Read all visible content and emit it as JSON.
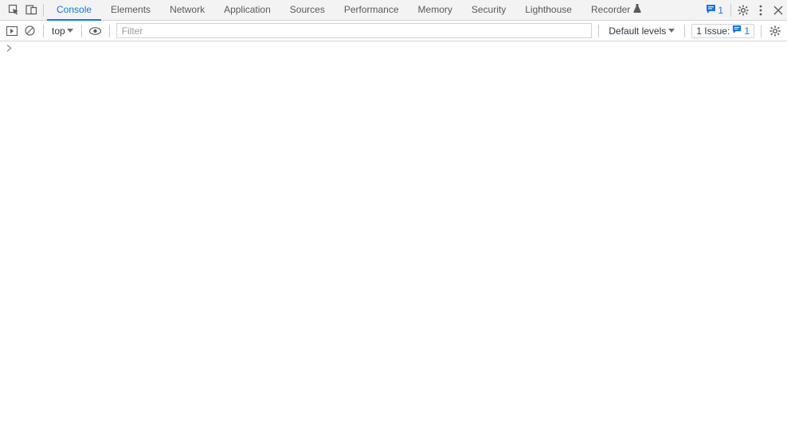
{
  "topbar": {
    "tabs": [
      {
        "label": "Console"
      },
      {
        "label": "Elements"
      },
      {
        "label": "Network"
      },
      {
        "label": "Application"
      },
      {
        "label": "Sources"
      },
      {
        "label": "Performance"
      },
      {
        "label": "Memory"
      },
      {
        "label": "Security"
      },
      {
        "label": "Lighthouse"
      },
      {
        "label": "Recorder"
      }
    ],
    "messages_count": "1"
  },
  "toolbar": {
    "context": "top",
    "filter_placeholder": "Filter",
    "levels_label": "Default levels",
    "issues_label": "1 Issue:",
    "issues_count": "1"
  }
}
